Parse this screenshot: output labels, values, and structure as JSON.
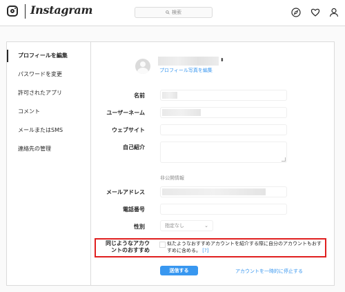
{
  "header": {
    "wordmark": "Instagram",
    "search": {
      "placeholder": "検索",
      "icon": "search-icon"
    },
    "icons": [
      "compass-icon",
      "heart-icon",
      "profile-icon"
    ]
  },
  "sidebar": {
    "items": [
      {
        "label": "プロフィールを編集",
        "active": true
      },
      {
        "label": "パスワードを変更",
        "active": false
      },
      {
        "label": "許可されたアプリ",
        "active": false
      },
      {
        "label": "コメント",
        "active": false
      },
      {
        "label": "メールまたはSMS",
        "active": false
      },
      {
        "label": "連絡先の管理",
        "active": false
      }
    ]
  },
  "profile": {
    "change_photo_label": "プロフィール写真を編集"
  },
  "form": {
    "name_label": "名前",
    "username_label": "ユーザーネーム",
    "website_label": "ウェブサイト",
    "bio_label": "自己紹介",
    "private_info_note": "非公開情報",
    "email_label": "メールアドレス",
    "phone_label": "電話番号",
    "gender_label": "性別",
    "gender_value": "指定なし",
    "similar_label_line1": "同じようなアカウ",
    "similar_label_line2": "ントのおすすめ",
    "similar_text": "似たようなおすすめアカウントを紹介する際に自分のアカウントもおすすめに含める。",
    "similar_help": "[?]",
    "submit_label": "送信する",
    "disable_label": "アカウントを一時的に停止する"
  },
  "colors": {
    "accent": "#3897f0",
    "highlight_box": "#e01e1e",
    "border": "#dbdbdb"
  }
}
